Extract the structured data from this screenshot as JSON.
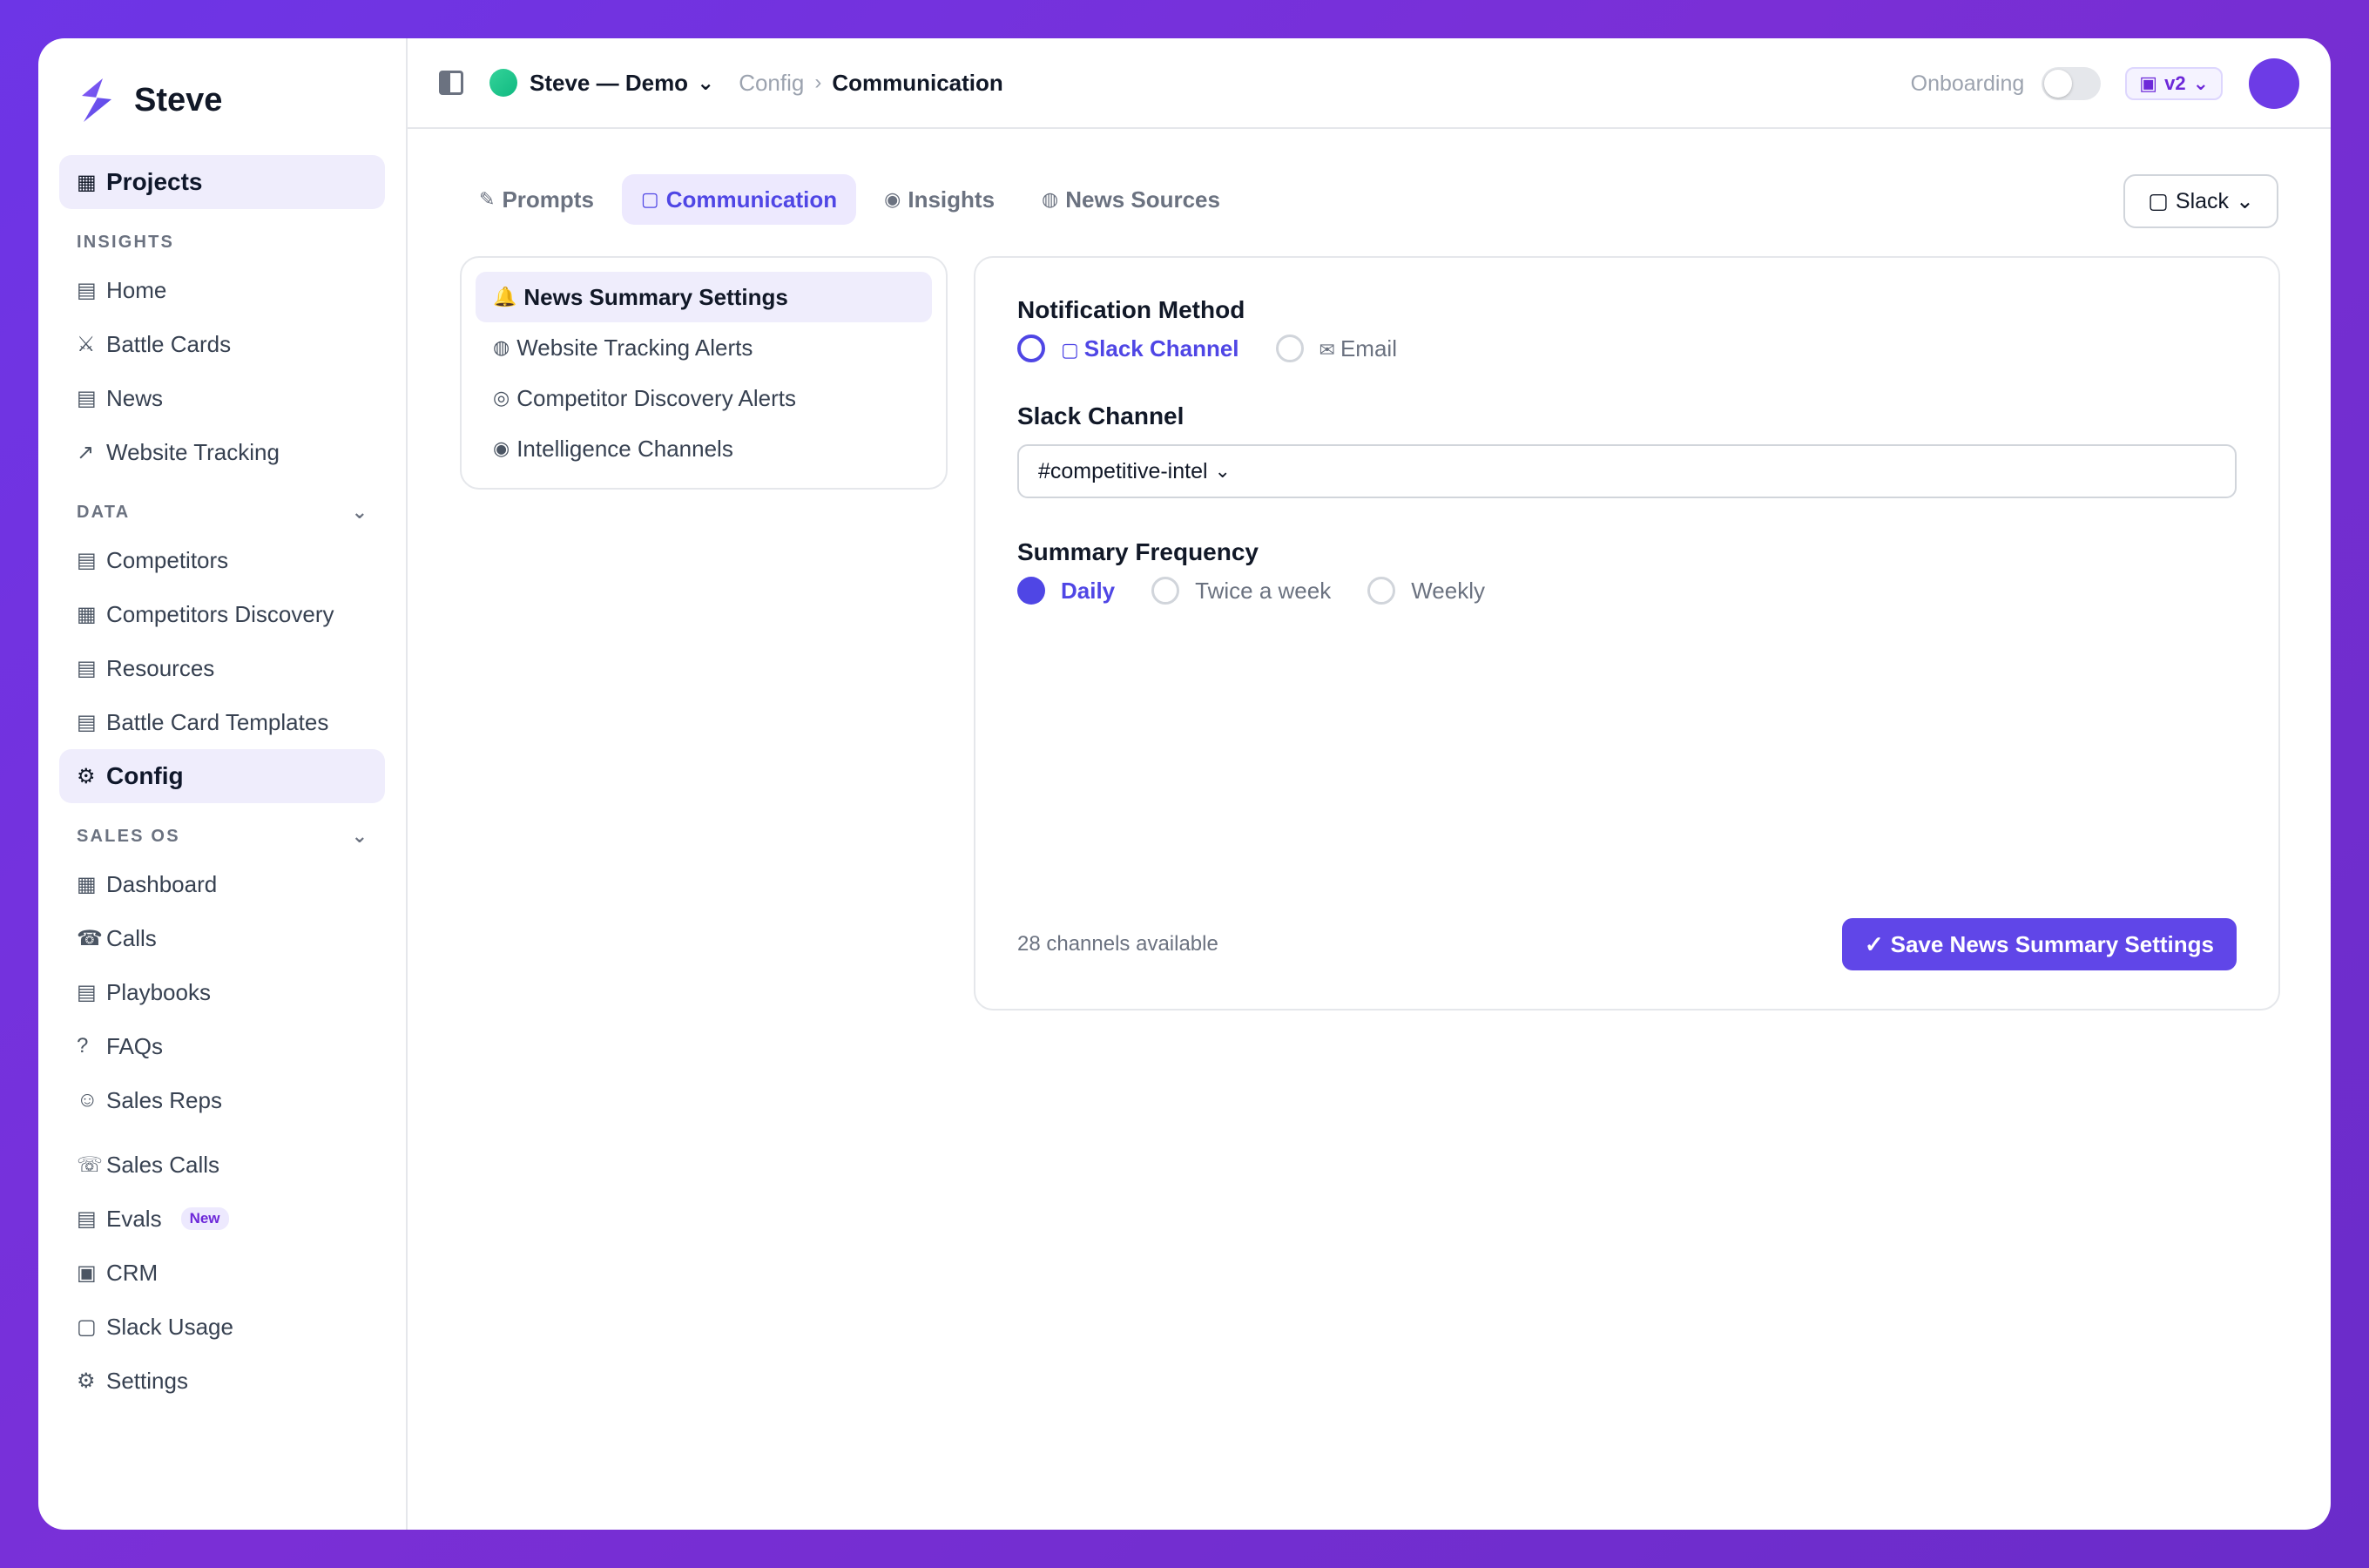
{
  "brand": {
    "name": "Steve"
  },
  "sidebar": {
    "projects": {
      "label": "Projects",
      "icon": "▦"
    },
    "sections": {
      "insights": {
        "label": "INSIGHTS"
      },
      "data": {
        "label": "DATA",
        "chevron": "⌄"
      },
      "sales_os": {
        "label": "SALES OS",
        "chevron": "⌄"
      }
    },
    "insights_items": [
      {
        "icon": "▤",
        "label": "Home"
      },
      {
        "icon": "⚔",
        "label": "Battle Cards"
      },
      {
        "icon": "▤",
        "label": "News"
      },
      {
        "icon": "↗",
        "label": "Website Tracking"
      }
    ],
    "data_items": [
      {
        "icon": "▤",
        "label": "Competitors"
      },
      {
        "icon": "▦",
        "label": "Competitors Discovery"
      },
      {
        "icon": "▤",
        "label": "Resources"
      },
      {
        "icon": "▤",
        "label": "Battle Card Templates"
      },
      {
        "icon": "⚙",
        "label": "Config"
      }
    ],
    "sales_items": [
      {
        "icon": "▦",
        "label": "Dashboard"
      },
      {
        "icon": "☎",
        "label": "Calls"
      },
      {
        "icon": "▤",
        "label": "Playbooks"
      },
      {
        "icon": "?",
        "label": "FAQs"
      },
      {
        "icon": "☺",
        "label": "Sales Reps"
      }
    ],
    "extra_items": [
      {
        "icon": "☏",
        "label": "Sales Calls"
      },
      {
        "icon": "▤",
        "label": "Evals",
        "badge": "New"
      },
      {
        "icon": "▣",
        "label": "CRM"
      },
      {
        "icon": "▢",
        "label": "Slack Usage"
      },
      {
        "icon": "⚙",
        "label": "Settings"
      }
    ]
  },
  "topbar": {
    "project": "Steve — Demo",
    "project_chevron": "⌄",
    "crumb_parent": "Config",
    "crumb_sep": "›",
    "crumb_current": "Communication",
    "onboarding": "Onboarding",
    "version": "v2",
    "version_icon": "▣",
    "version_chevron": "⌄"
  },
  "tabs": [
    {
      "icon": "✎",
      "label": "Prompts"
    },
    {
      "icon": "▢",
      "label": "Communication"
    },
    {
      "icon": "◉",
      "label": "Insights"
    },
    {
      "icon": "◍",
      "label": "News Sources"
    }
  ],
  "channel_select": {
    "icon": "▢",
    "label": "Slack",
    "chevron": "⌄"
  },
  "subnav": [
    {
      "icon": "🔔",
      "label": "News Summary Settings"
    },
    {
      "icon": "◍",
      "label": "Website Tracking Alerts"
    },
    {
      "icon": "◎",
      "label": "Competitor Discovery Alerts"
    },
    {
      "icon": "◉",
      "label": "Intelligence Channels"
    }
  ],
  "settings": {
    "notification_label": "Notification Method",
    "method_slack": {
      "icon": "▢",
      "label": "Slack Channel"
    },
    "method_email": {
      "icon": "✉",
      "label": "Email"
    },
    "slack_channel_label": "Slack Channel",
    "slack_channel_value": "#competitive-intel",
    "slack_channel_chevron": "⌄",
    "frequency_label": "Summary Frequency",
    "freq_daily": "Daily",
    "freq_twice": "Twice a week",
    "freq_weekly": "Weekly",
    "available": "28 channels available",
    "save_icon": "✓",
    "save_label": "Save News Summary Settings"
  },
  "colors": {
    "accent": "#4f46e5",
    "brand": "#6d3be6",
    "green": "#10b981"
  }
}
